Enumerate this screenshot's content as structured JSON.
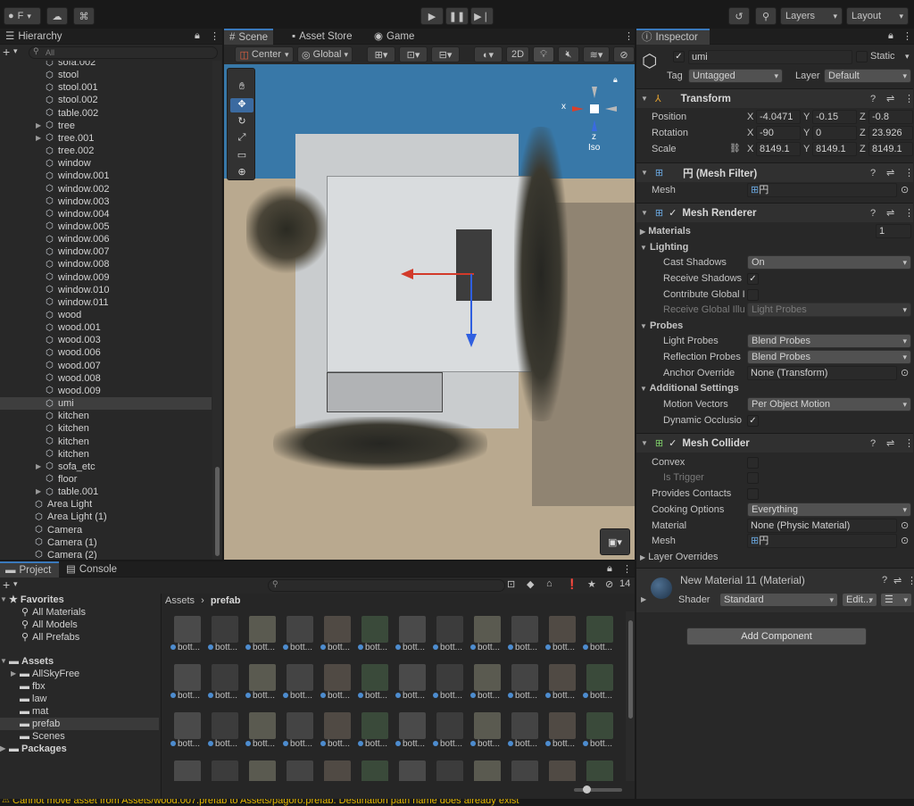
{
  "toolbar": {
    "account_label": "F",
    "play_icon": "play-icon",
    "pause_icon": "pause-icon",
    "step_icon": "step-icon",
    "layers_label": "Layers",
    "layout_label": "Layout"
  },
  "hierarchy": {
    "tab_label": "Hierarchy",
    "search_placeholder": "All",
    "items": [
      {
        "label": "sofa.002",
        "indent": 1
      },
      {
        "label": "stool",
        "indent": 1
      },
      {
        "label": "stool.001",
        "indent": 1
      },
      {
        "label": "stool.002",
        "indent": 1
      },
      {
        "label": "table.002",
        "indent": 1
      },
      {
        "label": "tree",
        "indent": 1,
        "arrow": true
      },
      {
        "label": "tree.001",
        "indent": 1,
        "arrow": true
      },
      {
        "label": "tree.002",
        "indent": 1
      },
      {
        "label": "window",
        "indent": 1
      },
      {
        "label": "window.001",
        "indent": 1
      },
      {
        "label": "window.002",
        "indent": 1
      },
      {
        "label": "window.003",
        "indent": 1
      },
      {
        "label": "window.004",
        "indent": 1
      },
      {
        "label": "window.005",
        "indent": 1
      },
      {
        "label": "window.006",
        "indent": 1
      },
      {
        "label": "window.007",
        "indent": 1
      },
      {
        "label": "window.008",
        "indent": 1
      },
      {
        "label": "window.009",
        "indent": 1
      },
      {
        "label": "window.010",
        "indent": 1
      },
      {
        "label": "window.011",
        "indent": 1
      },
      {
        "label": "wood",
        "indent": 1
      },
      {
        "label": "wood.001",
        "indent": 1
      },
      {
        "label": "wood.003",
        "indent": 1
      },
      {
        "label": "wood.006",
        "indent": 1
      },
      {
        "label": "wood.007",
        "indent": 1
      },
      {
        "label": "wood.008",
        "indent": 1
      },
      {
        "label": "wood.009",
        "indent": 1
      },
      {
        "label": "umi",
        "indent": 1,
        "selected": true
      },
      {
        "label": "kitchen",
        "indent": 1
      },
      {
        "label": "kitchen",
        "indent": 1
      },
      {
        "label": "kitchen",
        "indent": 1
      },
      {
        "label": "kitchen",
        "indent": 1
      },
      {
        "label": "sofa_etc",
        "indent": 1,
        "arrow": true
      },
      {
        "label": "floor",
        "indent": 1
      },
      {
        "label": "table.001",
        "indent": 1,
        "arrow": true
      },
      {
        "label": "Area Light",
        "indent": 0
      },
      {
        "label": "Area Light (1)",
        "indent": 0
      },
      {
        "label": "Camera",
        "indent": 0
      },
      {
        "label": "Camera (1)",
        "indent": 0
      },
      {
        "label": "Camera (2)",
        "indent": 0
      }
    ]
  },
  "scene": {
    "tabs": [
      "Scene",
      "Asset Store",
      "Game"
    ],
    "pivot_label": "Center",
    "space_label": "Global",
    "mode_2d": "2D",
    "gizmo_x": "x",
    "gizmo_z": "z",
    "iso_label": "Iso"
  },
  "inspector": {
    "tab_label": "Inspector",
    "object_name": "umi",
    "static_label": "Static",
    "tag_label": "Tag",
    "tag_value": "Untagged",
    "layer_label": "Layer",
    "layer_value": "Default",
    "transform": {
      "title": "Transform",
      "rows": [
        {
          "label": "Position",
          "x": "-4.0471",
          "y": "-0.15",
          "z": "-0.8"
        },
        {
          "label": "Rotation",
          "x": "-90",
          "y": "0",
          "z": "23.926"
        },
        {
          "label": "Scale",
          "x": "8149.1",
          "y": "8149.1",
          "z": "8149.1"
        }
      ]
    },
    "mesh_filter": {
      "title": "円 (Mesh Filter)",
      "mesh_label": "Mesh",
      "mesh_value": "円"
    },
    "mesh_renderer": {
      "title": "Mesh Renderer",
      "materials_label": "Materials",
      "materials_count": "1",
      "lighting_label": "Lighting",
      "cast_shadows_label": "Cast Shadows",
      "cast_shadows_value": "On",
      "receive_shadows_label": "Receive Shadows",
      "contribute_gi_label": "Contribute Global I",
      "receive_gi_label": "Receive Global Illu",
      "receive_gi_value": "Light Probes",
      "probes_label": "Probes",
      "light_probes_label": "Light Probes",
      "light_probes_value": "Blend Probes",
      "reflection_probes_label": "Reflection Probes",
      "reflection_probes_value": "Blend Probes",
      "anchor_override_label": "Anchor Override",
      "anchor_override_value": "None (Transform)",
      "additional_label": "Additional Settings",
      "motion_vectors_label": "Motion Vectors",
      "motion_vectors_value": "Per Object Motion",
      "dynamic_occlusion_label": "Dynamic Occlusio"
    },
    "mesh_collider": {
      "title": "Mesh Collider",
      "convex_label": "Convex",
      "is_trigger_label": "Is Trigger",
      "provides_contacts_label": "Provides Contacts",
      "cooking_label": "Cooking Options",
      "cooking_value": "Everything",
      "material_label": "Material",
      "material_value": "None (Physic Material)",
      "mesh_label": "Mesh",
      "mesh_value": "円",
      "layer_overrides_label": "Layer Overrides"
    },
    "material": {
      "title": "New Material 11 (Material)",
      "shader_label": "Shader",
      "shader_value": "Standard",
      "edit_label": "Edit..."
    },
    "add_component_label": "Add Component"
  },
  "project": {
    "tabs": [
      "Project",
      "Console"
    ],
    "favorites_label": "Favorites",
    "favorites": [
      "All Materials",
      "All Models",
      "All Prefabs"
    ],
    "assets_label": "Assets",
    "folders": [
      "AllSkyFree",
      "fbx",
      "law",
      "mat",
      "prefab",
      "Scenes"
    ],
    "packages_label": "Packages",
    "breadcrumb_root": "Assets",
    "breadcrumb_leaf": "prefab",
    "hidden_count": "14",
    "item_label": "bott..."
  },
  "status_bar": {
    "message": "Cannot move asset from Assets/wood.007.prefab to Assets/pagoro.prefab. Destination path name does already exist"
  }
}
